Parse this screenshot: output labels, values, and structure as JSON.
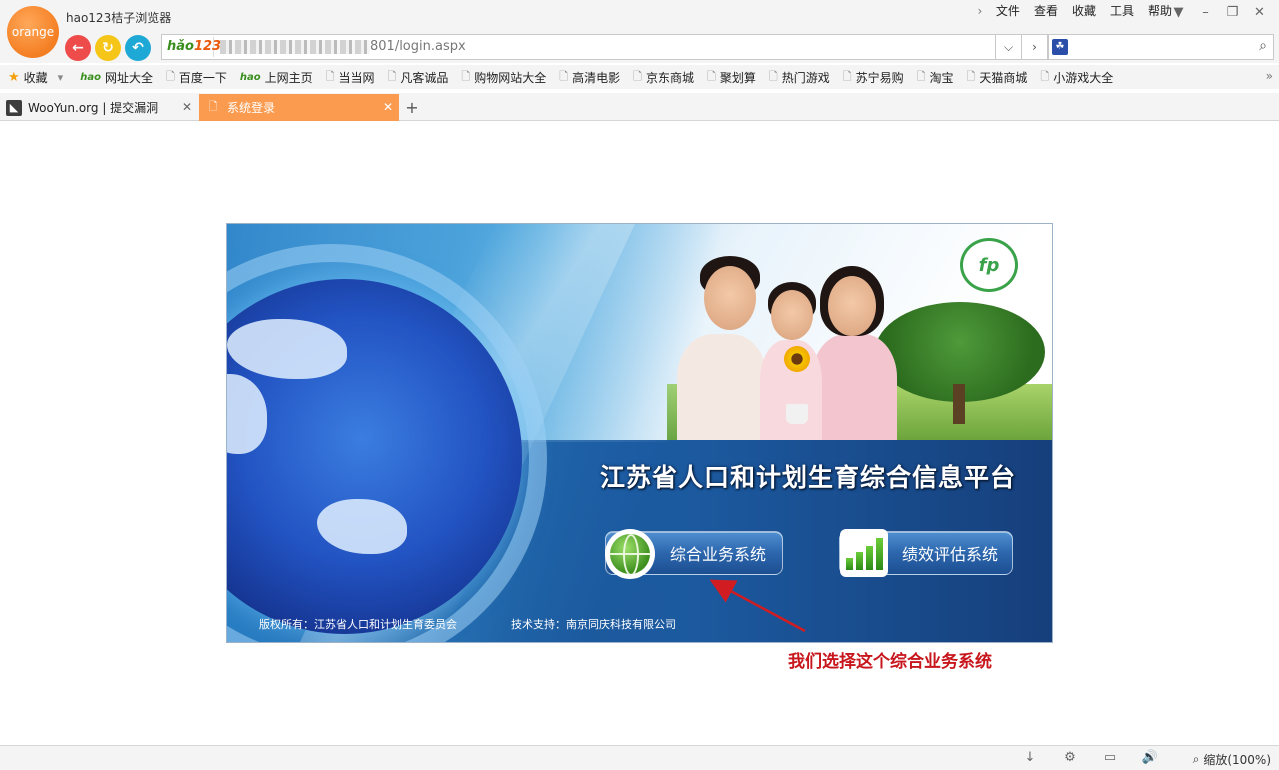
{
  "window": {
    "logo_text": "orange",
    "title": "hao123桔子浏览器",
    "menu": [
      "文件",
      "查看",
      "收藏",
      "工具",
      "帮助"
    ]
  },
  "address_bar": {
    "badge_prefix": "hǎo",
    "badge_suffix": "123",
    "url_visible": "801/login.aspx",
    "search_value": ""
  },
  "bookmarks": [
    {
      "label": "收藏",
      "icon": "star-icon"
    },
    {
      "label": "网址大全",
      "icon": "hao-icon"
    },
    {
      "label": "百度一下",
      "icon": "page-icon"
    },
    {
      "label": "上网主页",
      "icon": "hao-icon"
    },
    {
      "label": "当当网",
      "icon": "page-icon"
    },
    {
      "label": "凡客诚品",
      "icon": "page-icon"
    },
    {
      "label": "购物网站大全",
      "icon": "page-icon"
    },
    {
      "label": "高清电影",
      "icon": "page-icon"
    },
    {
      "label": "京东商城",
      "icon": "page-icon"
    },
    {
      "label": "聚划算",
      "icon": "page-icon"
    },
    {
      "label": "热门游戏",
      "icon": "page-icon"
    },
    {
      "label": "苏宁易购",
      "icon": "page-icon"
    },
    {
      "label": "淘宝",
      "icon": "page-icon"
    },
    {
      "label": "天猫商城",
      "icon": "page-icon"
    },
    {
      "label": "小游戏大全",
      "icon": "page-icon"
    }
  ],
  "tabs": [
    {
      "label": "WooYun.org | 提交漏洞",
      "active": false
    },
    {
      "label": "系统登录",
      "active": true
    }
  ],
  "content": {
    "platform_title": "江苏省人口和计划生育综合信息平台",
    "button_integrated": "综合业务系统",
    "button_performance": "绩效评估系统",
    "copyright": "版权所有：江苏省人口和计划生育委员会",
    "tech_support": "技术支持：南京同庆科技有限公司",
    "annotation": "我们选择这个综合业务系统",
    "annotation_color": "#c8161d"
  },
  "status": {
    "zoom_label": "缩放(100%)"
  },
  "colors": {
    "accent": "#fa9b50",
    "logo": "#f47e22"
  }
}
